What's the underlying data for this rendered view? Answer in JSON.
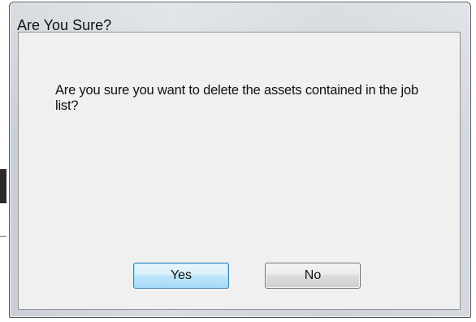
{
  "dialog": {
    "title": "Are You Sure?",
    "message": "Are you sure you want to delete the assets contained in the job list?",
    "buttons": {
      "yes_label": "Yes",
      "no_label": "No"
    },
    "default_button": "yes"
  }
}
